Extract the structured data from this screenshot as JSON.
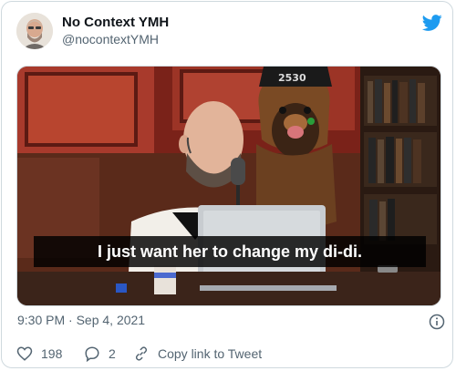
{
  "tweet": {
    "display_name": "No Context YMH",
    "handle": "@nocontextYMH",
    "timestamp": "9:30 PM · Sep 4, 2021",
    "caption": "I just want her to change my di-di.",
    "hat_text": "2530"
  },
  "actions": {
    "likes": "198",
    "replies": "2",
    "copy_label": "Copy link to Tweet"
  },
  "colors": {
    "twitter_blue": "#1d9bf0",
    "secondary_text": "#536471",
    "border": "#cfd9de"
  },
  "icons": {
    "logo": "twitter-bird-icon",
    "info": "info-icon",
    "like": "heart-icon",
    "reply": "reply-bubble-icon",
    "copy": "link-icon"
  }
}
